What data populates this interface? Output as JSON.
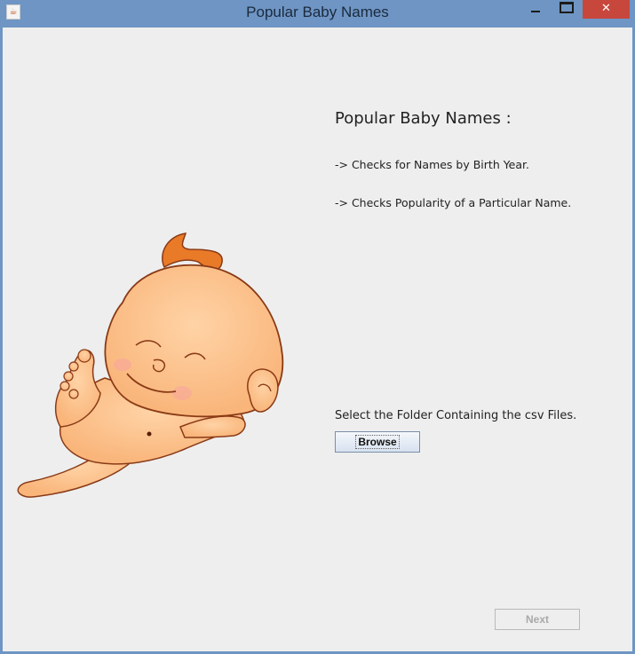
{
  "window": {
    "title": "Popular Baby Names",
    "close_glyph": "✕",
    "app_icon_glyph": "☕"
  },
  "main": {
    "heading": "Popular Baby Names :",
    "feature_1": "-> Checks for Names by Birth Year.",
    "feature_2": "-> Checks Popularity of a Particular Name.",
    "select_label": "Select the Folder Containing the csv Files.",
    "browse_label": "Browse",
    "next_label": "Next"
  },
  "colors": {
    "titlebar": "#6e95c4",
    "close_button": "#c8473c",
    "client_bg": "#eeeeee",
    "baby_skin": "#fcbf88",
    "baby_hair": "#e97a28",
    "baby_outline": "#8a3a16"
  }
}
